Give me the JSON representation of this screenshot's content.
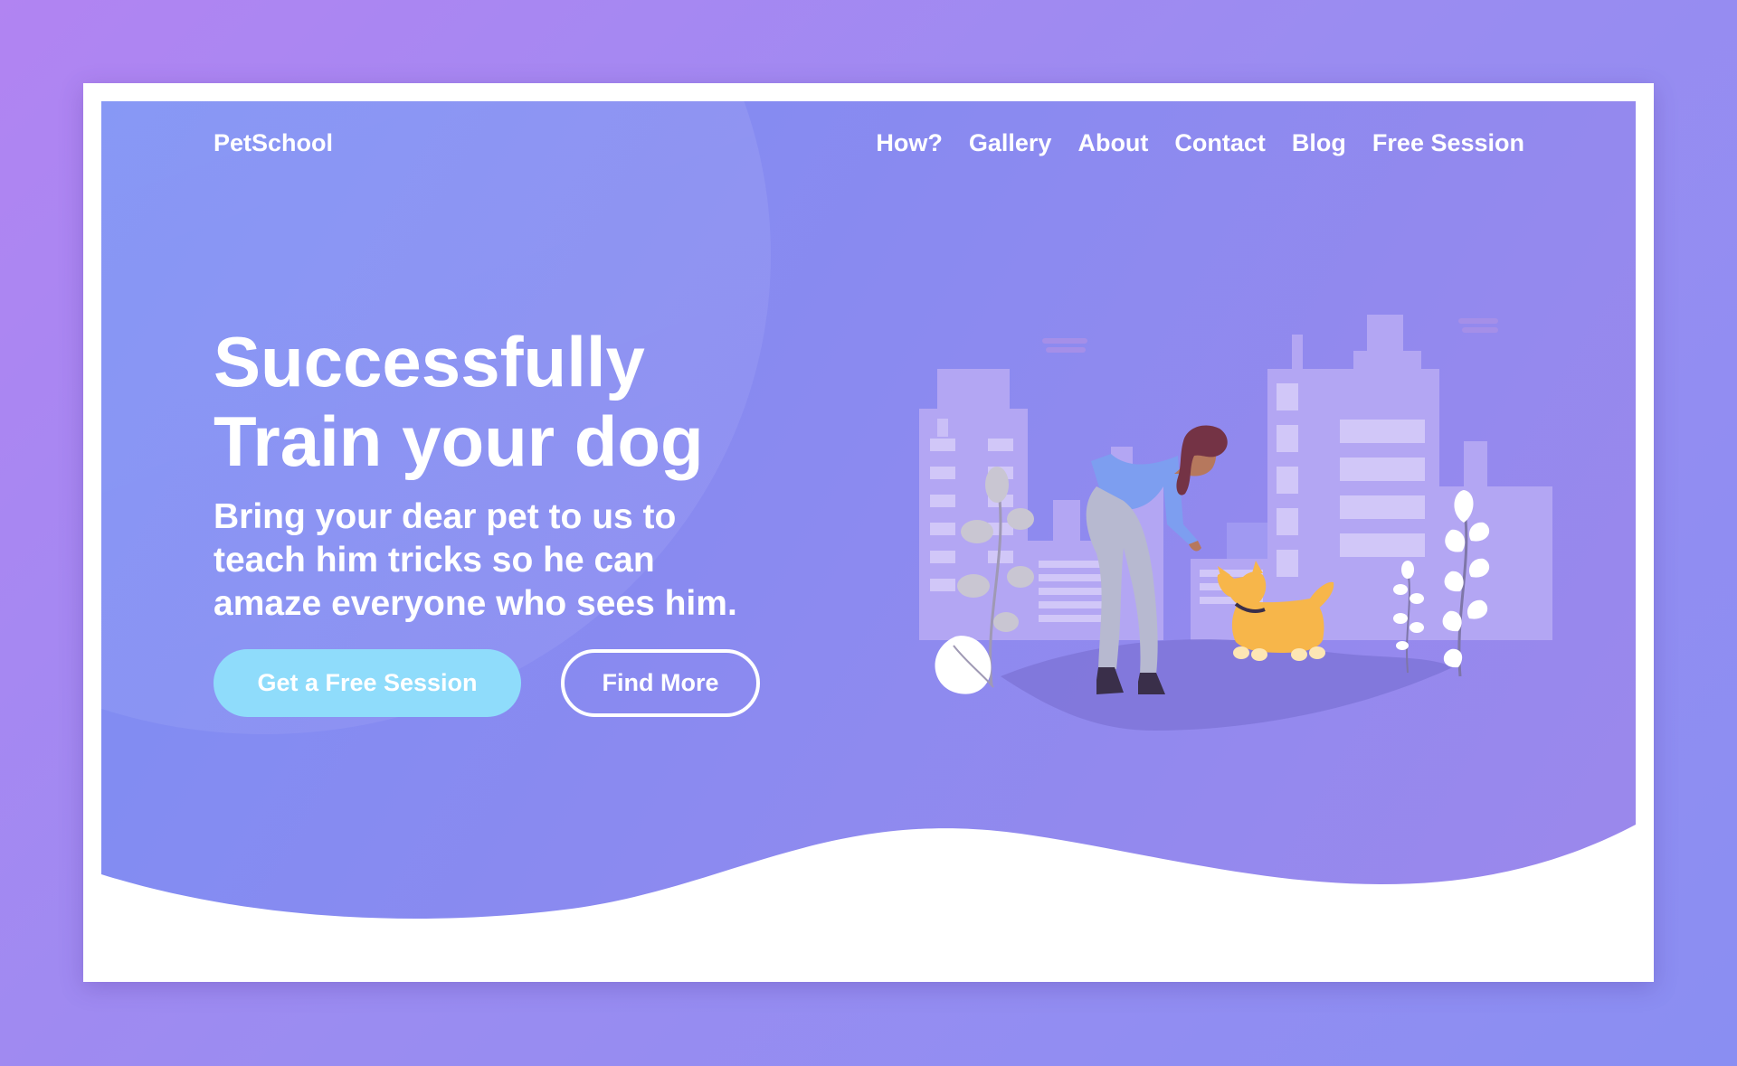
{
  "brand": "PetSchool",
  "nav": [
    {
      "label": "How?"
    },
    {
      "label": "Gallery"
    },
    {
      "label": "About"
    },
    {
      "label": "Contact"
    },
    {
      "label": "Blog"
    },
    {
      "label": "Free Session"
    }
  ],
  "hero": {
    "headline_line1": "Successfully",
    "headline_line2": "Train your dog",
    "subtext_line1": "Bring your dear pet to us to",
    "subtext_line2": "teach him tricks so he can",
    "subtext_line3": "amaze everyone who sees him.",
    "primary_button": "Get a Free Session",
    "secondary_button": "Find More"
  },
  "colors": {
    "background": "#9a8cf1",
    "hero_gradient_start": "#7c8ef4",
    "hero_gradient_end": "#9c88ec",
    "primary_button": "#8fdcfb",
    "text": "#ffffff"
  },
  "illustration": {
    "icons": [
      "city-skyline-icon",
      "person-icon",
      "dog-icon",
      "plant-icon"
    ]
  }
}
